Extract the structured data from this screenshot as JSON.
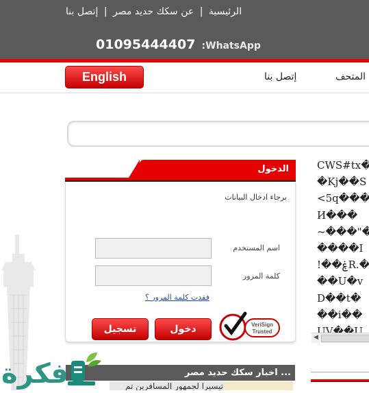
{
  "header": {
    "links": [
      "الرئيسية",
      "عن سكك حديد مصر",
      "إتصل بنا"
    ],
    "separator": "|",
    "whatsapp_number": "01095444407",
    "whatsapp_label": ":WhatsApp"
  },
  "nav": {
    "language_button": "English",
    "items": [
      "إتصل بنا",
      "المتحف"
    ]
  },
  "login": {
    "title": "الدخول",
    "prompt": "برجاء ادخال البيانات",
    "username_label": "اسم المستخدم",
    "password_label": "كلمة المرور",
    "forgot_link": "فقدت كلمة المرور ؟",
    "login_button": "دخول",
    "register_button": "تسجيل",
    "badge_line1": "VeriSign",
    "badge_line2": "Trusted"
  },
  "garbled_lines": [
    "CWS#tx�",
    "�Kj��S",
    "<5q���",
    "И���",
    "~���\"�",
    "����I",
    "!��ۼR.�",
    "��U�v",
    "D��t�",
    "��i��",
    "UV��U"
  ],
  "news": {
    "title": "اخبار سكك حديد مصر ...",
    "item": "تيسيرا لجمهور المسافرين تم"
  },
  "watermark": {
    "text": "فكرة"
  },
  "colors": {
    "accent_red": "#e40000",
    "header_gray": "#5a5a5a",
    "link_blue": "#1a4fb0",
    "logo_teal": "#1a8a7a"
  }
}
